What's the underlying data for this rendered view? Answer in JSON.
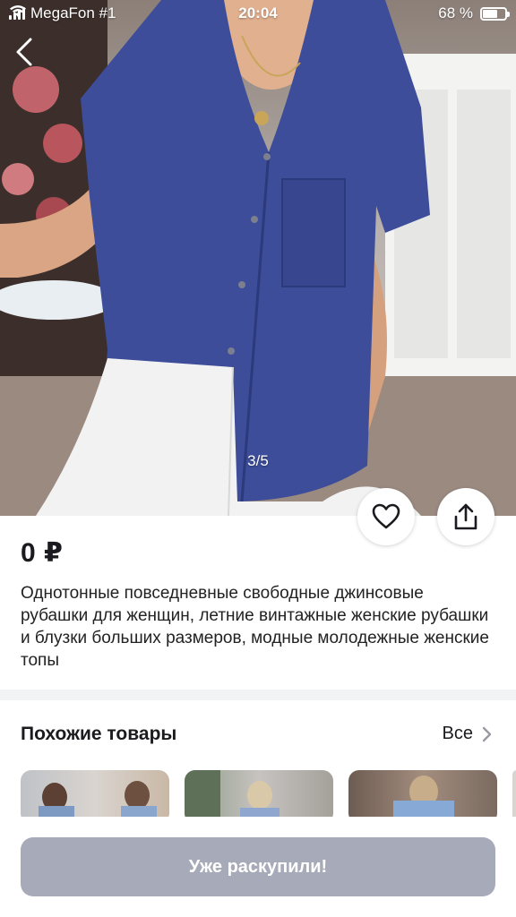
{
  "status_bar": {
    "carrier": "MegaFon #1",
    "time": "20:04",
    "battery_percent": "68 %",
    "battery_level": 0.68
  },
  "gallery": {
    "counter": "3/5"
  },
  "product": {
    "price": "0 ₽",
    "description": "Однотонные повседневные свободные джинсовые рубашки для женщин, летние винтажные женские рубашки и блузки больших размеров, модные молодежные женские топы"
  },
  "similar": {
    "title": "Похожие товары",
    "all_label": "Все"
  },
  "bottom": {
    "sold_out_label": "Уже раскупили!"
  },
  "icons": {
    "back": "chevron-left-icon",
    "favorite": "heart-icon",
    "share": "share-icon",
    "all": "chevron-right-icon"
  },
  "colors": {
    "shirt": "#3d4d9a",
    "sold_out_button": "#a7aab8",
    "divider": "#f2f3f5"
  }
}
